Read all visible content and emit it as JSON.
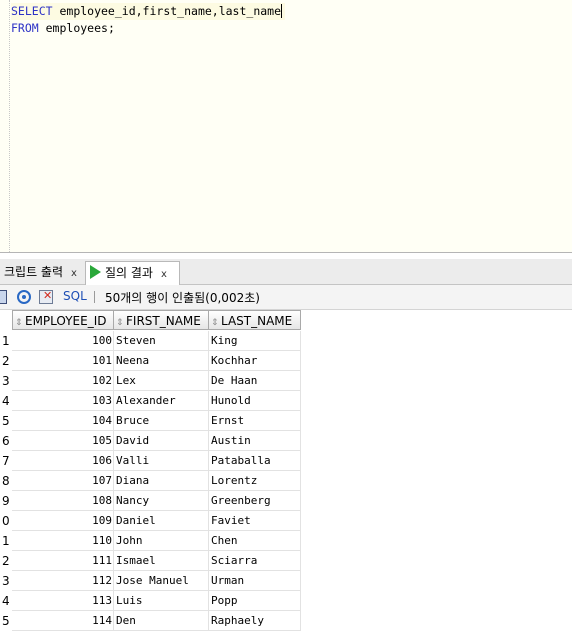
{
  "editor": {
    "line1": {
      "keyword": "SELECT",
      "rest": " employee_id,first_name,last_name"
    },
    "line2": {
      "keyword": "FROM",
      "rest": " employees;"
    }
  },
  "tabs": [
    {
      "label": "크립트 출력",
      "close": "x",
      "active": false
    },
    {
      "label": "질의 결과",
      "close": "x",
      "active": true
    }
  ],
  "toolbar": {
    "sql_label": "SQL",
    "separator": "|",
    "status": "50개의 행이 인출됨(0,002초)"
  },
  "grid": {
    "columns": [
      "EMPLOYEE_ID",
      "FIRST_NAME",
      "LAST_NAME"
    ],
    "rows": [
      {
        "num": "1",
        "id": "100",
        "first": "Steven",
        "last": "King"
      },
      {
        "num": "2",
        "id": "101",
        "first": "Neena",
        "last": "Kochhar"
      },
      {
        "num": "3",
        "id": "102",
        "first": "Lex",
        "last": "De Haan"
      },
      {
        "num": "4",
        "id": "103",
        "first": "Alexander",
        "last": "Hunold"
      },
      {
        "num": "5",
        "id": "104",
        "first": "Bruce",
        "last": "Ernst"
      },
      {
        "num": "6",
        "id": "105",
        "first": "David",
        "last": "Austin"
      },
      {
        "num": "7",
        "id": "106",
        "first": "Valli",
        "last": "Pataballa"
      },
      {
        "num": "8",
        "id": "107",
        "first": "Diana",
        "last": "Lorentz"
      },
      {
        "num": "9",
        "id": "108",
        "first": "Nancy",
        "last": "Greenberg"
      },
      {
        "num": "0",
        "id": "109",
        "first": "Daniel",
        "last": "Faviet"
      },
      {
        "num": "1",
        "id": "110",
        "first": "John",
        "last": "Chen"
      },
      {
        "num": "2",
        "id": "111",
        "first": "Ismael",
        "last": "Sciarra"
      },
      {
        "num": "3",
        "id": "112",
        "first": "Jose Manuel",
        "last": "Urman"
      },
      {
        "num": "4",
        "id": "113",
        "first": "Luis",
        "last": "Popp"
      },
      {
        "num": "5",
        "id": "114",
        "first": "Den",
        "last": "Raphaely"
      }
    ]
  },
  "colors": {
    "keyword": "#2e33c6",
    "run_icon": "#2aa83a",
    "sql_link": "#1e4fb5"
  }
}
